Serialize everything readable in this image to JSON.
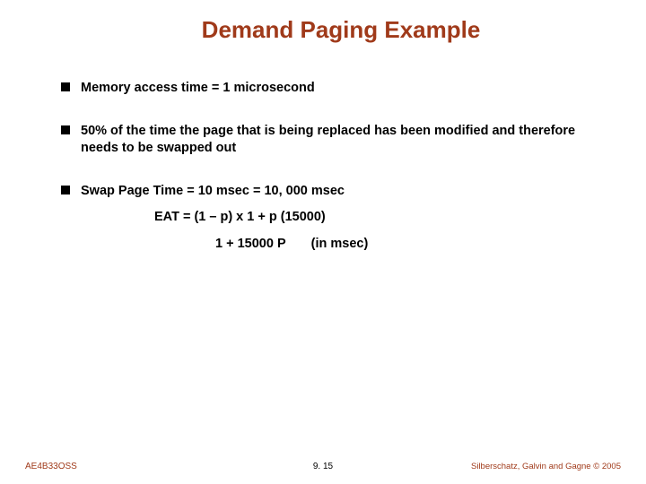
{
  "title": "Demand Paging Example",
  "bullets": {
    "b1": "Memory access time = 1 microsecond",
    "b2": "50% of the time the page that is being replaced has been modified and therefore needs to be swapped out",
    "b3": "Swap Page Time = 10 msec = 10, 000 msec"
  },
  "lines": {
    "eat1": "EAT = (1 – p) x 1 + p (15000)",
    "eat2a": "1 + 15000 P",
    "eat2b": "(in msec)"
  },
  "footer": {
    "left": "AE4B33OSS",
    "center": "9. 15",
    "right": "Silberschatz, Galvin and Gagne © 2005"
  }
}
